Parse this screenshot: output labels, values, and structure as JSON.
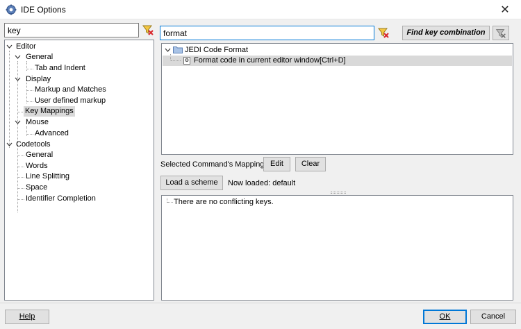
{
  "window": {
    "title": "IDE Options",
    "icon": "ide-options-gear-icon",
    "close_glyph": "✕"
  },
  "left_filter": {
    "value": "key",
    "placeholder": ""
  },
  "command_filter": {
    "value": "format",
    "placeholder": ""
  },
  "find_key_combination_label": "Find key combination",
  "options_tree": [
    {
      "label": "Editor",
      "level": 0,
      "expanded": true
    },
    {
      "label": "General",
      "level": 1,
      "expanded": true
    },
    {
      "label": "Tab and Indent",
      "level": 2
    },
    {
      "label": "Display",
      "level": 1,
      "expanded": true
    },
    {
      "label": "Markup and Matches",
      "level": 2
    },
    {
      "label": "User defined markup",
      "level": 2
    },
    {
      "label": "Key Mappings",
      "level": 1,
      "selected": true
    },
    {
      "label": "Mouse",
      "level": 1,
      "expanded": true
    },
    {
      "label": "Advanced",
      "level": 2
    },
    {
      "label": "Codetools",
      "level": 0,
      "expanded": true
    },
    {
      "label": "General",
      "level": 1
    },
    {
      "label": "Words",
      "level": 1
    },
    {
      "label": "Line Splitting",
      "level": 1
    },
    {
      "label": "Space",
      "level": 1
    },
    {
      "label": "Identifier Completion",
      "level": 1
    }
  ],
  "command_tree": {
    "group": {
      "label": "JEDI Code Format",
      "icon": "folder-icon",
      "expanded": true
    },
    "command": {
      "label": "Format code in current editor window",
      "shortcut": "[Ctrl+D]",
      "icon": "command-icon"
    }
  },
  "mapping": {
    "label": "Selected Command's Mapping",
    "edit_label": "Edit",
    "clear_label": "Clear",
    "load_scheme_label": "Load a scheme",
    "now_loaded": "Now loaded: default"
  },
  "conflicts": {
    "message": "There are no conflicting keys."
  },
  "footer": {
    "help_label": "Help",
    "ok_label": "OK",
    "cancel_label": "Cancel"
  },
  "colors": {
    "accent": "#0078d7",
    "selection": "#d9d9d9",
    "clear_filter_red": "#d9262c",
    "clear_filter_yellow": "#f3c642"
  }
}
